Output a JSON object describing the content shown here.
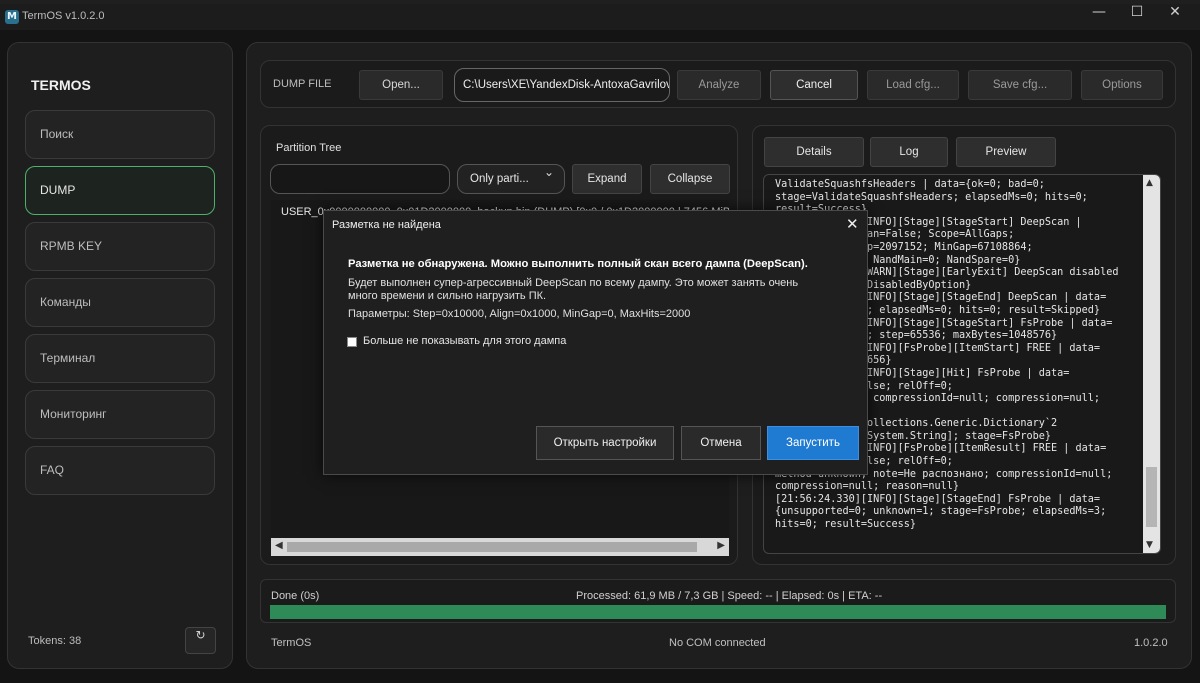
{
  "window": {
    "title": "TermOS v1.0.2.0",
    "app_icon": "M",
    "min_glyph": "—",
    "max_glyph": "☐",
    "close_glyph": "✕"
  },
  "sidebar": {
    "brand": "TERMOS",
    "items": [
      {
        "label": "Поиск",
        "active": false
      },
      {
        "label": "DUMP",
        "active": true
      },
      {
        "label": "RPMB KEY",
        "active": false
      },
      {
        "label": "Команды",
        "active": false
      },
      {
        "label": "Терминал",
        "active": false
      },
      {
        "label": "Мониторинг",
        "active": false
      },
      {
        "label": "FAQ",
        "active": false
      }
    ],
    "tokens": "Tokens: 38",
    "refresh_glyph": "↻"
  },
  "toolbar": {
    "label": "DUMP FILE",
    "open": "Open...",
    "path": "C:\\Users\\XE\\YandexDisk-AntoxaGavrilov\\",
    "analyze": "Analyze",
    "cancel": "Cancel",
    "load_cfg": "Load cfg...",
    "save_cfg": "Save cfg...",
    "options": "Options"
  },
  "partition": {
    "title": "Partition Tree",
    "search_value": "",
    "filter": "Only parti...",
    "expand": "Expand",
    "collapse": "Collapse",
    "row": "USER_0x0000000000_0x01D2000000_backup.bin (DUMP)  [0x0 / 0x1D2000000 | 7456 MiB] [FS"
  },
  "details": {
    "tabs": [
      "Details",
      "Log",
      "Preview"
    ],
    "log_lines": [
      "ValidateSquashfsHeaders | data={ok=0; bad=0;",
      "stage=ValidateSquashfsHeaders; elapsedMs=0; hits=0;",
      "result=Success}",
      "[21:56:24.330][INFO][Stage][StageStart] DeepScan |",
      "data={useDeepScan=False; Scope=AllGaps;",
      "Align=4096; Step=2097152; MinGap=67108864;",
      "NandStream=Raw; NandMain=0; NandSpare=0}",
      "[21:56:24.330][WARN][Stage][EarlyExit] DeepScan disabled",
      "| data={reason=DisabledByOption}",
      "[21:56:24.330][INFO][Stage][StageEnd] DeepScan | data=",
      "{stage=DeepScan; elapsedMs=0; hits=0; result=Skipped}",
      "[21:56:24.330][INFO][Stage][StageStart] FsProbe | data=",
      "{window=8388608; step=65536; maxBytes=1048576}",
      "[21:56:24.330][INFO][FsProbe][ItemStart] FREE | data=",
      "{length=7818182656}",
      "[21:56:24.330][INFO][Stage][Hit] FsProbe | data=",
      "{unsupported=False; relOff=0;",
      "method=unknown; compressionId=null; compression=null;",
      "reason=null;",
      "counts=System.Collections.Generic.Dictionary`2",
      "[System.String,System.String]; stage=FsProbe}",
      "[21:56:24.330][INFO][FsProbe][ItemResult] FREE | data=",
      "{unsupported=False; relOff=0;",
      "method=unknown; note=Не распознано; compressionId=null;",
      "compression=null; reason=null}",
      "[21:56:24.330][INFO][Stage][StageEnd] FsProbe | data=",
      "{unsupported=0; unknown=1; stage=FsProbe; elapsedMs=3;",
      "hits=0; result=Success}"
    ]
  },
  "progress": {
    "status": "Done (0s)",
    "stats": "Processed: 61,9 MB / 7,3 GB | Speed: -- | Elapsed: 0s | ETA: --",
    "fraction": 1.0
  },
  "footer": {
    "left": "TermOS",
    "mid": "No COM connected",
    "right": "1.0.2.0"
  },
  "dialog": {
    "title": "Разметка не найдена",
    "close_glyph": "✕",
    "headline": "Разметка не обнаружена. Можно выполнить полный скан всего дампа (DeepScan).",
    "body": "Будет выполнен супер-агрессивный DeepScan по всему дампу. Это может занять очень много времени и сильно нагрузить ПК.",
    "params": "Параметры: Step=0x10000, Align=0x1000, MinGap=0, MaxHits=2000",
    "checkbox": "Больше не показывать для этого дампа",
    "checkbox_checked": false,
    "open_settings": "Открыть настройки",
    "cancel": "Отмена",
    "run": "Запустить"
  },
  "colors": {
    "accent_green": "#2e8a57",
    "active_border": "#4fb06a",
    "primary_blue": "#1f7ad1"
  }
}
